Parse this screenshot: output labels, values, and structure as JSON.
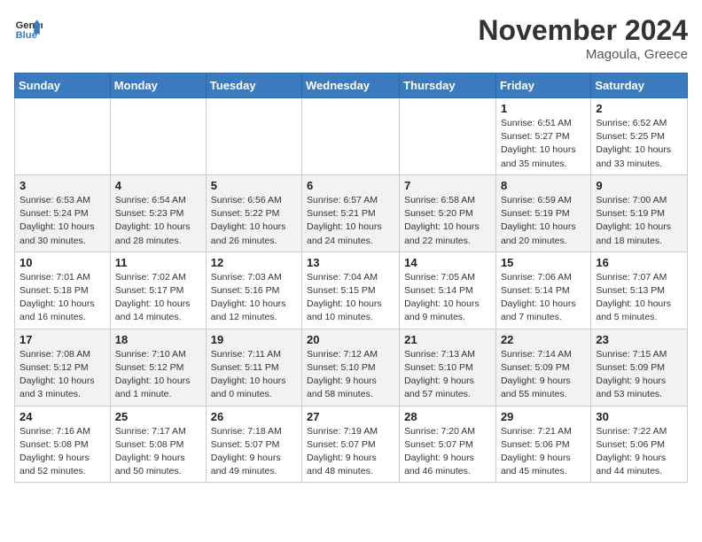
{
  "header": {
    "logo_line1": "General",
    "logo_line2": "Blue",
    "month_title": "November 2024",
    "location": "Magoula, Greece"
  },
  "columns": [
    "Sunday",
    "Monday",
    "Tuesday",
    "Wednesday",
    "Thursday",
    "Friday",
    "Saturday"
  ],
  "weeks": [
    [
      {
        "day": "",
        "info": ""
      },
      {
        "day": "",
        "info": ""
      },
      {
        "day": "",
        "info": ""
      },
      {
        "day": "",
        "info": ""
      },
      {
        "day": "",
        "info": ""
      },
      {
        "day": "1",
        "info": "Sunrise: 6:51 AM\nSunset: 5:27 PM\nDaylight: 10 hours and 35 minutes."
      },
      {
        "day": "2",
        "info": "Sunrise: 6:52 AM\nSunset: 5:25 PM\nDaylight: 10 hours and 33 minutes."
      }
    ],
    [
      {
        "day": "3",
        "info": "Sunrise: 6:53 AM\nSunset: 5:24 PM\nDaylight: 10 hours and 30 minutes."
      },
      {
        "day": "4",
        "info": "Sunrise: 6:54 AM\nSunset: 5:23 PM\nDaylight: 10 hours and 28 minutes."
      },
      {
        "day": "5",
        "info": "Sunrise: 6:56 AM\nSunset: 5:22 PM\nDaylight: 10 hours and 26 minutes."
      },
      {
        "day": "6",
        "info": "Sunrise: 6:57 AM\nSunset: 5:21 PM\nDaylight: 10 hours and 24 minutes."
      },
      {
        "day": "7",
        "info": "Sunrise: 6:58 AM\nSunset: 5:20 PM\nDaylight: 10 hours and 22 minutes."
      },
      {
        "day": "8",
        "info": "Sunrise: 6:59 AM\nSunset: 5:19 PM\nDaylight: 10 hours and 20 minutes."
      },
      {
        "day": "9",
        "info": "Sunrise: 7:00 AM\nSunset: 5:19 PM\nDaylight: 10 hours and 18 minutes."
      }
    ],
    [
      {
        "day": "10",
        "info": "Sunrise: 7:01 AM\nSunset: 5:18 PM\nDaylight: 10 hours and 16 minutes."
      },
      {
        "day": "11",
        "info": "Sunrise: 7:02 AM\nSunset: 5:17 PM\nDaylight: 10 hours and 14 minutes."
      },
      {
        "day": "12",
        "info": "Sunrise: 7:03 AM\nSunset: 5:16 PM\nDaylight: 10 hours and 12 minutes."
      },
      {
        "day": "13",
        "info": "Sunrise: 7:04 AM\nSunset: 5:15 PM\nDaylight: 10 hours and 10 minutes."
      },
      {
        "day": "14",
        "info": "Sunrise: 7:05 AM\nSunset: 5:14 PM\nDaylight: 10 hours and 9 minutes."
      },
      {
        "day": "15",
        "info": "Sunrise: 7:06 AM\nSunset: 5:14 PM\nDaylight: 10 hours and 7 minutes."
      },
      {
        "day": "16",
        "info": "Sunrise: 7:07 AM\nSunset: 5:13 PM\nDaylight: 10 hours and 5 minutes."
      }
    ],
    [
      {
        "day": "17",
        "info": "Sunrise: 7:08 AM\nSunset: 5:12 PM\nDaylight: 10 hours and 3 minutes."
      },
      {
        "day": "18",
        "info": "Sunrise: 7:10 AM\nSunset: 5:12 PM\nDaylight: 10 hours and 1 minute."
      },
      {
        "day": "19",
        "info": "Sunrise: 7:11 AM\nSunset: 5:11 PM\nDaylight: 10 hours and 0 minutes."
      },
      {
        "day": "20",
        "info": "Sunrise: 7:12 AM\nSunset: 5:10 PM\nDaylight: 9 hours and 58 minutes."
      },
      {
        "day": "21",
        "info": "Sunrise: 7:13 AM\nSunset: 5:10 PM\nDaylight: 9 hours and 57 minutes."
      },
      {
        "day": "22",
        "info": "Sunrise: 7:14 AM\nSunset: 5:09 PM\nDaylight: 9 hours and 55 minutes."
      },
      {
        "day": "23",
        "info": "Sunrise: 7:15 AM\nSunset: 5:09 PM\nDaylight: 9 hours and 53 minutes."
      }
    ],
    [
      {
        "day": "24",
        "info": "Sunrise: 7:16 AM\nSunset: 5:08 PM\nDaylight: 9 hours and 52 minutes."
      },
      {
        "day": "25",
        "info": "Sunrise: 7:17 AM\nSunset: 5:08 PM\nDaylight: 9 hours and 50 minutes."
      },
      {
        "day": "26",
        "info": "Sunrise: 7:18 AM\nSunset: 5:07 PM\nDaylight: 9 hours and 49 minutes."
      },
      {
        "day": "27",
        "info": "Sunrise: 7:19 AM\nSunset: 5:07 PM\nDaylight: 9 hours and 48 minutes."
      },
      {
        "day": "28",
        "info": "Sunrise: 7:20 AM\nSunset: 5:07 PM\nDaylight: 9 hours and 46 minutes."
      },
      {
        "day": "29",
        "info": "Sunrise: 7:21 AM\nSunset: 5:06 PM\nDaylight: 9 hours and 45 minutes."
      },
      {
        "day": "30",
        "info": "Sunrise: 7:22 AM\nSunset: 5:06 PM\nDaylight: 9 hours and 44 minutes."
      }
    ]
  ]
}
